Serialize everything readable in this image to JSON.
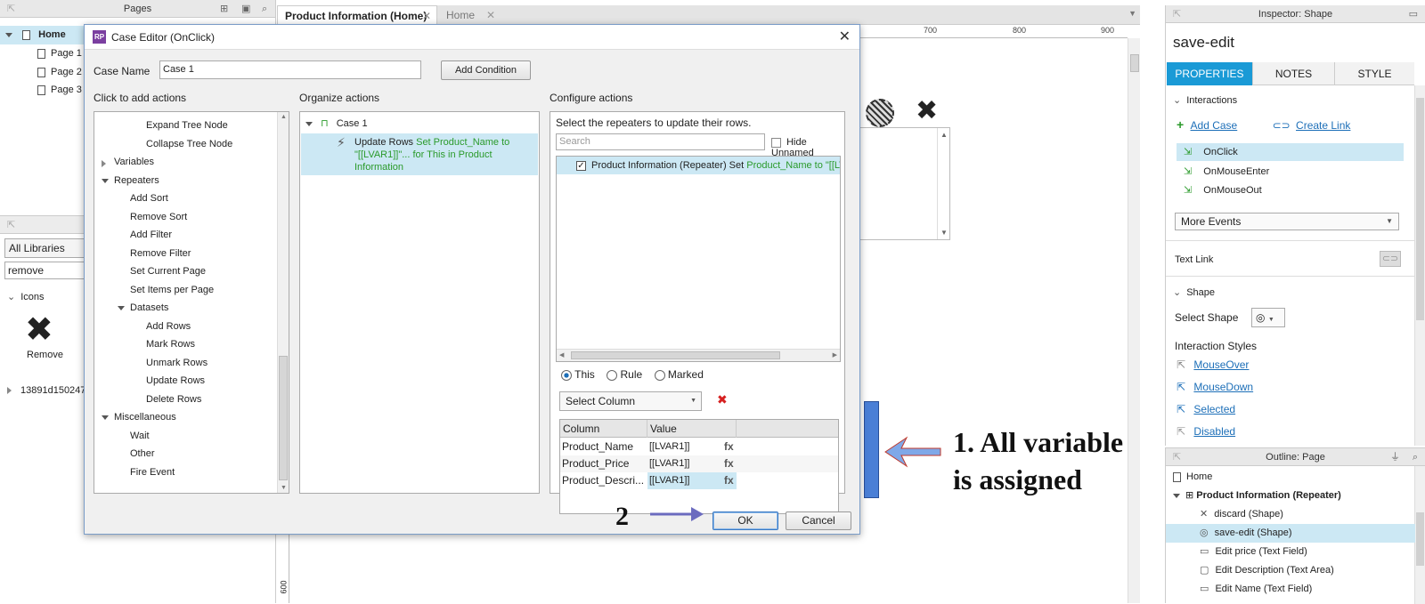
{
  "pages_panel": {
    "title": "Pages",
    "items": [
      "Home",
      "Page 1",
      "Page 2",
      "Page 3"
    ]
  },
  "libraries_panel": {
    "selector": "All Libraries",
    "search_value": "remove",
    "group": "Icons",
    "icon_label": "Remove",
    "footer_item": "13891d150247"
  },
  "tabs": [
    {
      "label": "Product Information (Home)"
    },
    {
      "label": "Home"
    }
  ],
  "ruler": {
    "marks": [
      "700",
      "800",
      "900"
    ],
    "vertical_mark": "600"
  },
  "dialog": {
    "title": "Case Editor (OnClick)",
    "case_name_label": "Case Name",
    "case_name_value": "Case 1",
    "add_condition": "Add Condition",
    "col1_title": "Click to add actions",
    "col2_title": "Organize actions",
    "col3_title": "Configure actions",
    "actions": [
      {
        "label": "Expand Tree Node",
        "level": 3
      },
      {
        "label": "Collapse Tree Node",
        "level": 3
      },
      {
        "label": "Variables",
        "level": 0,
        "toggle": "collapsed"
      },
      {
        "label": "Repeaters",
        "level": 0,
        "toggle": "expanded"
      },
      {
        "label": "Add Sort",
        "level": 2
      },
      {
        "label": "Remove Sort",
        "level": 2
      },
      {
        "label": "Add Filter",
        "level": 2
      },
      {
        "label": "Remove Filter",
        "level": 2
      },
      {
        "label": "Set Current Page",
        "level": 2
      },
      {
        "label": "Set Items per Page",
        "level": 2
      },
      {
        "label": "Datasets",
        "level": 1,
        "toggle": "expanded"
      },
      {
        "label": "Add Rows",
        "level": 3
      },
      {
        "label": "Mark Rows",
        "level": 3
      },
      {
        "label": "Unmark Rows",
        "level": 3
      },
      {
        "label": "Update Rows",
        "level": 3
      },
      {
        "label": "Delete Rows",
        "level": 3
      },
      {
        "label": "Miscellaneous",
        "level": 0,
        "toggle": "expanded"
      },
      {
        "label": "Wait",
        "level": 2
      },
      {
        "label": "Other",
        "level": 2
      },
      {
        "label": "Fire Event",
        "level": 2
      }
    ],
    "organize": {
      "case_label": "Case 1",
      "action_name": "Update Rows",
      "action_detail_1": " Set Product_Name to",
      "action_detail_2": "\"[[LVAR1]]\"... for This in Product",
      "action_detail_3": "Information"
    },
    "configure": {
      "instruction": "Select the repeaters to update their rows.",
      "search_placeholder": "Search",
      "hide_unnamed": "Hide Unnamed",
      "repeater_row_prefix": "Product Information (Repeater) Set ",
      "repeater_row_detail": "Product_Name to \"[[LVA",
      "radio_this": "This",
      "radio_rule": "Rule",
      "radio_marked": "Marked",
      "select_column": "Select Column",
      "grid_headers": [
        "Column",
        "Value"
      ],
      "grid_rows": [
        {
          "column": "Product_Name",
          "value": "[[LVAR1]]",
          "fx": "fx"
        },
        {
          "column": "Product_Price",
          "value": "[[LVAR1]]",
          "fx": "fx"
        },
        {
          "column": "Product_Descri...",
          "value": "[[LVAR1]]",
          "fx": "fx"
        }
      ]
    },
    "ok": "OK",
    "cancel": "Cancel"
  },
  "annotations": {
    "note_1_line1": "1. All variable",
    "note_1_line2": "is assigned",
    "note_2": "2"
  },
  "inspector": {
    "title": "Inspector: Shape",
    "element_name": "save-edit",
    "tabs": [
      "PROPERTIES",
      "NOTES",
      "STYLE"
    ],
    "interactions_header": "Interactions",
    "add_case": "Add Case",
    "create_link": "Create Link",
    "events": [
      "OnClick",
      "OnMouseEnter",
      "OnMouseOut"
    ],
    "more_events": "More Events",
    "text_link": "Text Link",
    "shape_header": "Shape",
    "select_shape": "Select Shape",
    "interaction_styles": "Interaction Styles",
    "styles": [
      "MouseOver",
      "MouseDown",
      "Selected",
      "Disabled"
    ]
  },
  "outline": {
    "title": "Outline: Page",
    "root": "Home",
    "repeater": "Product Information (Repeater)",
    "children": [
      "discard (Shape)",
      "save-edit (Shape)",
      "Edit price (Text Field)",
      "Edit Description (Text Area)",
      "Edit Name (Text Field)"
    ]
  },
  "colors": {
    "accent": "#1a9ad6",
    "selection": "#cce8f4",
    "annotation_bar": "#4a7fd6"
  }
}
